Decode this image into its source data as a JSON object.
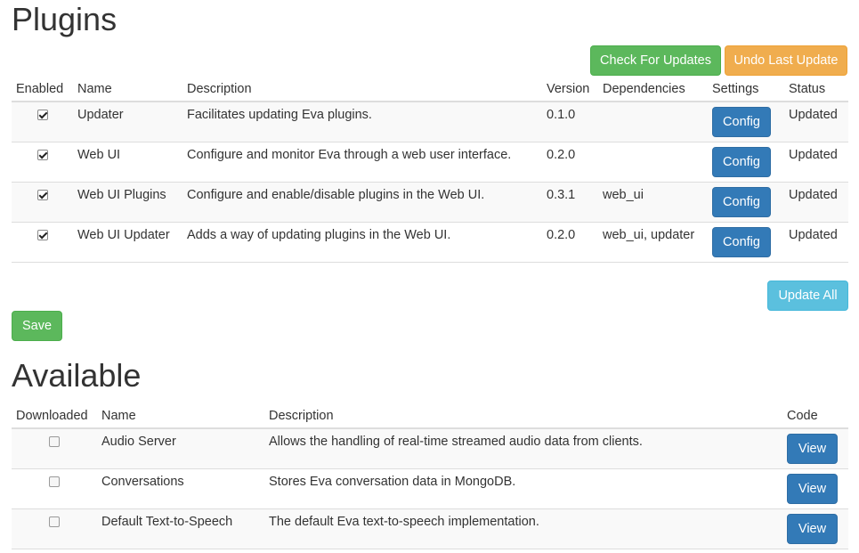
{
  "plugins": {
    "title": "Plugins",
    "check_updates_label": "Check For Updates",
    "undo_update_label": "Undo Last Update",
    "update_all_label": "Update All",
    "save_label": "Save",
    "columns": [
      "Enabled",
      "Name",
      "Description",
      "Version",
      "Dependencies",
      "Settings",
      "Status"
    ],
    "rows": [
      {
        "enabled": true,
        "name": "Updater",
        "description": "Facilitates updating Eva plugins.",
        "version": "0.1.0",
        "dependencies": "",
        "settings_label": "Config",
        "status": "Updated"
      },
      {
        "enabled": true,
        "name": "Web UI",
        "description": "Configure and monitor Eva through a web user interface.",
        "version": "0.2.0",
        "dependencies": "",
        "settings_label": "Config",
        "status": "Updated"
      },
      {
        "enabled": true,
        "name": "Web UI Plugins",
        "description": "Configure and enable/disable plugins in the Web UI.",
        "version": "0.3.1",
        "dependencies": "web_ui",
        "settings_label": "Config",
        "status": "Updated"
      },
      {
        "enabled": true,
        "name": "Web UI Updater",
        "description": "Adds a way of updating plugins in the Web UI.",
        "version": "0.2.0",
        "dependencies": "web_ui, updater",
        "settings_label": "Config",
        "status": "Updated"
      }
    ]
  },
  "available": {
    "title": "Available",
    "columns": [
      "Downloaded",
      "Name",
      "Description",
      "Code"
    ],
    "rows": [
      {
        "downloaded": false,
        "name": "Audio Server",
        "description": "Allows the handling of real-time streamed audio data from clients.",
        "code_label": "View"
      },
      {
        "downloaded": false,
        "name": "Conversations",
        "description": "Stores Eva conversation data in MongoDB.",
        "code_label": "View"
      },
      {
        "downloaded": false,
        "name": "Default Text-to-Speech",
        "description": "The default Eva text-to-speech implementation.",
        "code_label": "View"
      }
    ]
  },
  "colors": {
    "success": "#5cb85c",
    "warning": "#f0ad4e",
    "info": "#5bc0de",
    "primary": "#337ab7"
  }
}
